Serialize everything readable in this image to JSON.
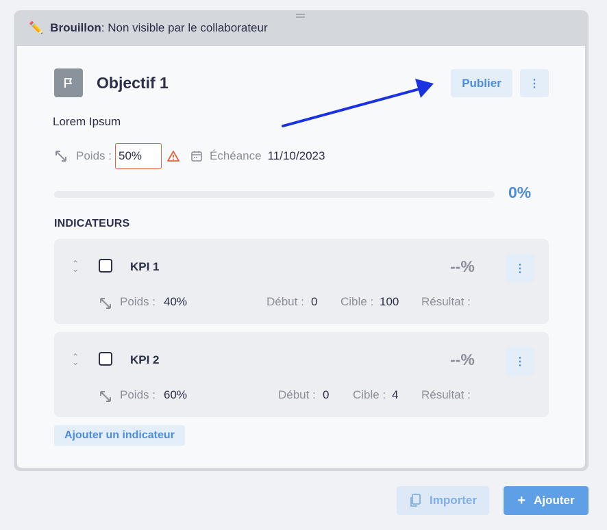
{
  "status": {
    "icon": "pencil-icon",
    "draft_label": "Brouillon",
    "draft_text": ": Non visible par le collaborateur"
  },
  "objective": {
    "icon": "flag-icon",
    "title": "Objectif 1",
    "publish_label": "Publier",
    "description": "Lorem Ipsum",
    "weight_label": "Poids :",
    "weight_value": "50%",
    "due_label": "Échéance",
    "due_value": "11/10/2023",
    "progress_value": 0,
    "progress_label": "0%"
  },
  "indicators": {
    "section_title": "INDICATEURS",
    "items": [
      {
        "name": "KPI 1",
        "pct": "--%",
        "weight_label": "Poids :",
        "weight": "40%",
        "start_label": "Début :",
        "start": "0",
        "target_label": "Cible :",
        "target": "100",
        "result_label": "Résultat :"
      },
      {
        "name": "KPI 2",
        "pct": "--%",
        "weight_label": "Poids :",
        "weight": "60%",
        "start_label": "Début :",
        "start": "0",
        "target_label": "Cible :",
        "target": "4",
        "result_label": "Résultat :"
      }
    ],
    "add_label": "Ajouter un indicateur"
  },
  "footer": {
    "import_label": "Importer",
    "add_label": "Ajouter"
  },
  "colors": {
    "accent": "#4e8ddc",
    "warning": "#e0633b",
    "annotation_arrow": "#1a32e0"
  }
}
